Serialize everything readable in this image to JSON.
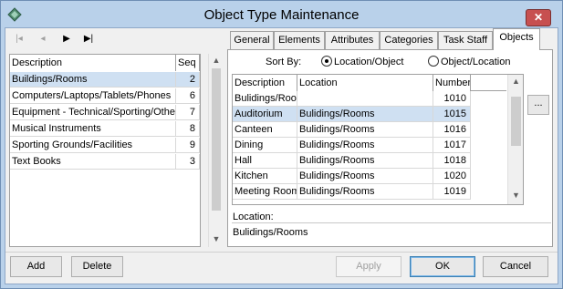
{
  "window": {
    "title": "Object Type Maintenance",
    "close_glyph": "✕"
  },
  "toolbar": {
    "first_glyph": "|◂",
    "prev_glyph": "◂",
    "next_glyph": "▶",
    "last_glyph": "▶|"
  },
  "left_grid": {
    "headers": {
      "description": "Description",
      "seq": "Seq"
    },
    "rows": [
      {
        "description": "Buildings/Rooms",
        "seq": "2"
      },
      {
        "description": "Computers/Laptops/Tablets/Phones",
        "seq": "6"
      },
      {
        "description": "Equipment - Technical/Sporting/Other",
        "seq": "7"
      },
      {
        "description": "Musical Instruments",
        "seq": "8"
      },
      {
        "description": "Sporting Grounds/Facilities",
        "seq": "9"
      },
      {
        "description": "Text Books",
        "seq": "3"
      }
    ]
  },
  "tabs": [
    "General",
    "Elements",
    "Attributes",
    "Categories",
    "Task Staff",
    "Objects"
  ],
  "objects_tab": {
    "sort_by_label": "Sort By:",
    "sort_options": [
      "Location/Object",
      "Object/Location"
    ],
    "headers": {
      "description": "Description",
      "location": "Location",
      "number": "Number"
    },
    "rows": [
      {
        "description": "Bulidings/Rooms",
        "location": "",
        "number": "1010"
      },
      {
        "description": "Auditorium",
        "location": "Bulidings/Rooms",
        "number": "1015"
      },
      {
        "description": "Canteen",
        "location": "Bulidings/Rooms",
        "number": "1016"
      },
      {
        "description": "Dining",
        "location": "Bulidings/Rooms",
        "number": "1017"
      },
      {
        "description": "Hall",
        "location": "Bulidings/Rooms",
        "number": "1018"
      },
      {
        "description": "Kitchen",
        "location": "Bulidings/Rooms",
        "number": "1020"
      },
      {
        "description": "Meeting Room",
        "location": "Bulidings/Rooms",
        "number": "1019"
      }
    ],
    "ellipsis_label": "...",
    "location_label": "Location:",
    "location_value": "Bulidings/Rooms"
  },
  "buttons": {
    "add": "Add",
    "delete": "Delete",
    "apply": "Apply",
    "ok": "OK",
    "cancel": "Cancel"
  }
}
